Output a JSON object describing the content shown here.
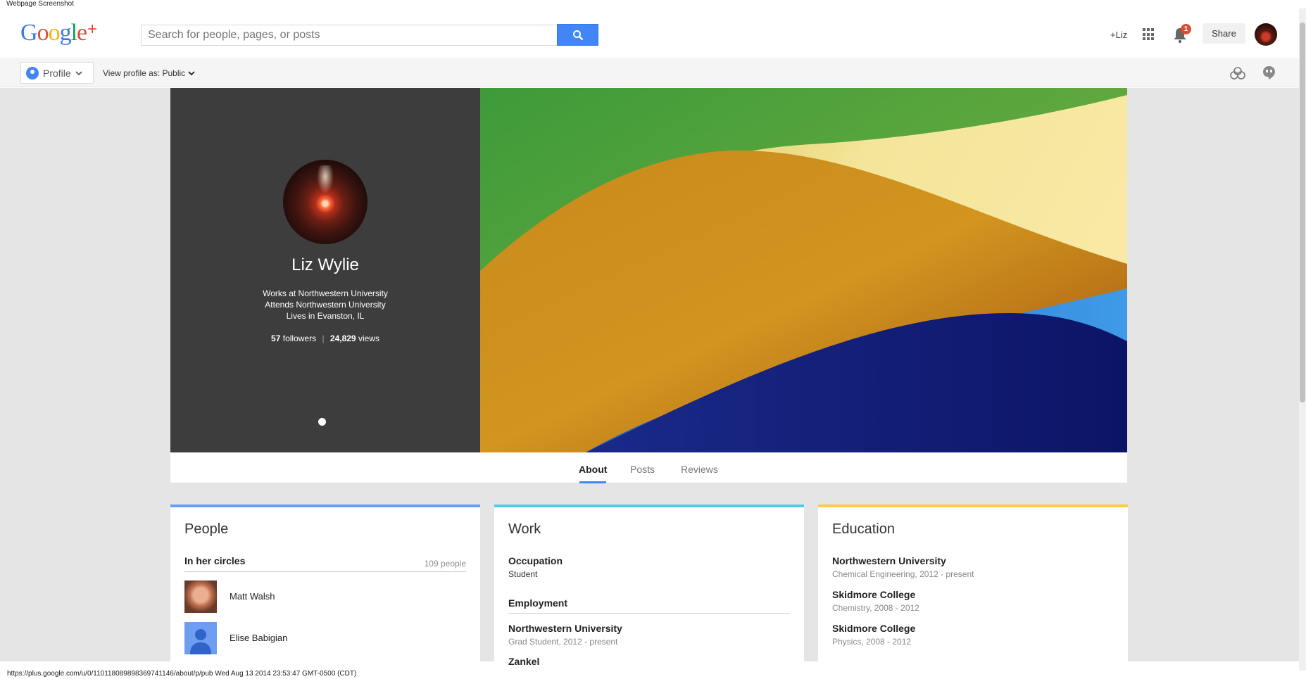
{
  "screenshot_label": "Webpage Screenshot",
  "header": {
    "logo": "Google+",
    "search_placeholder": "Search for people, pages, or posts",
    "user_link": "+Liz",
    "notification_count": "1",
    "share_label": "Share"
  },
  "subnav": {
    "profile_label": "Profile",
    "view_as_label": "View profile as:",
    "view_as_value": "Public"
  },
  "profile": {
    "name": "Liz Wylie",
    "work": "Works at Northwestern University",
    "school": "Attends Northwestern University",
    "location": "Lives in Evanston, IL",
    "followers_count": "57",
    "followers_label": "followers",
    "views_count": "24,829",
    "views_label": "views"
  },
  "tabs": [
    {
      "label": "About",
      "active": true
    },
    {
      "label": "Posts",
      "active": false
    },
    {
      "label": "Reviews",
      "active": false
    }
  ],
  "people_card": {
    "title": "People",
    "accent": "#679df6",
    "section": "In her circles",
    "count": "109 people",
    "people": [
      {
        "name": "Matt Walsh"
      },
      {
        "name": "Elise Babigian"
      }
    ]
  },
  "work_card": {
    "title": "Work",
    "accent": "#4ecde6",
    "occupation_head": "Occupation",
    "occupation": "Student",
    "employment_head": "Employment",
    "employers": [
      {
        "name": "Northwestern University",
        "detail": "Grad Student, 2012 - present"
      },
      {
        "name": "Zankel",
        "detail": ""
      }
    ]
  },
  "education_card": {
    "title": "Education",
    "accent": "#fbcb43",
    "schools": [
      {
        "name": "Northwestern University",
        "detail": "Chemical Engineering, 2012 - present"
      },
      {
        "name": "Skidmore College",
        "detail": "Chemistry, 2008 - 2012"
      },
      {
        "name": "Skidmore College",
        "detail": "Physics, 2008 - 2012"
      }
    ]
  },
  "status_bar": "https://plus.google.com/u/0/110118089898369741146/about/p/pub Wed Aug 13 2014 23:53:47 GMT-0500 (CDT)",
  "icons": [
    "search-icon",
    "apps-icon",
    "bell-icon",
    "circles-icon",
    "hangouts-icon",
    "chevron-down-icon"
  ]
}
